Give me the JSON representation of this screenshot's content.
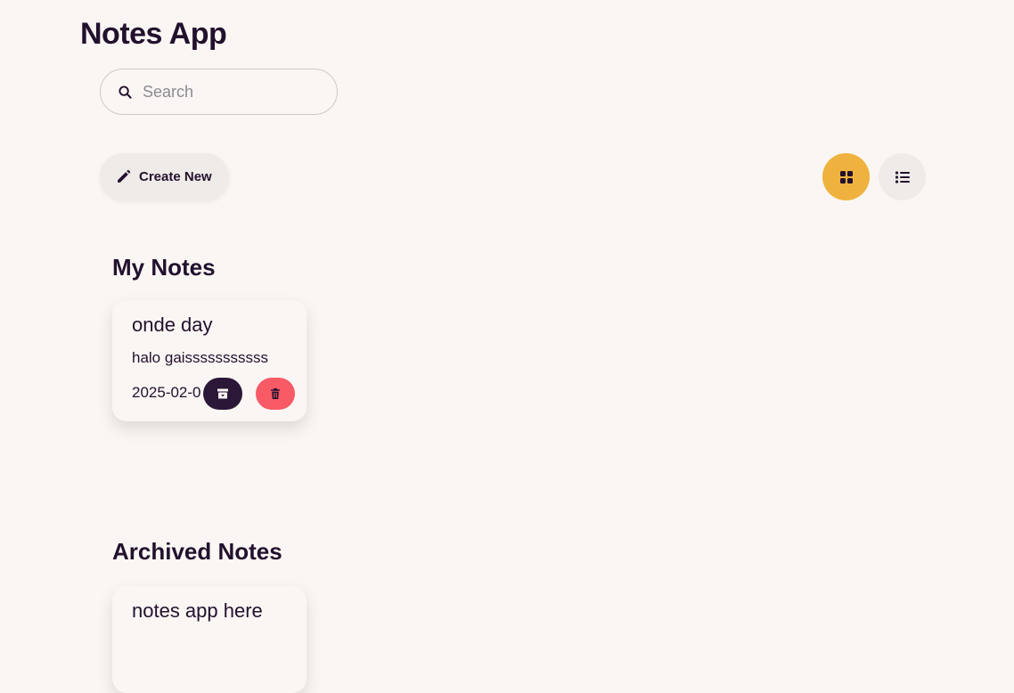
{
  "app": {
    "title": "Notes App"
  },
  "search": {
    "placeholder": "Search",
    "value": ""
  },
  "toolbar": {
    "create_label": "Create New",
    "active_view": "grid",
    "accent_color": "#efb23e"
  },
  "sections": {
    "my_notes": {
      "title": "My Notes",
      "notes": [
        {
          "title": "onde day",
          "body": "halo gaisssssssssss",
          "date": "2025-02-0"
        }
      ]
    },
    "archived": {
      "title": "Archived Notes",
      "notes": [
        {
          "title": "notes app here"
        }
      ]
    }
  },
  "colors": {
    "background": "#faf6f3",
    "text": "#22112e",
    "archive_button": "#2b1738",
    "delete_button": "#f85a66"
  },
  "icons": {
    "search": "search-icon",
    "create": "pencil-icon",
    "grid_view": "grid-icon",
    "list_view": "list-icon",
    "archive": "archive-icon",
    "delete": "trash-icon"
  }
}
